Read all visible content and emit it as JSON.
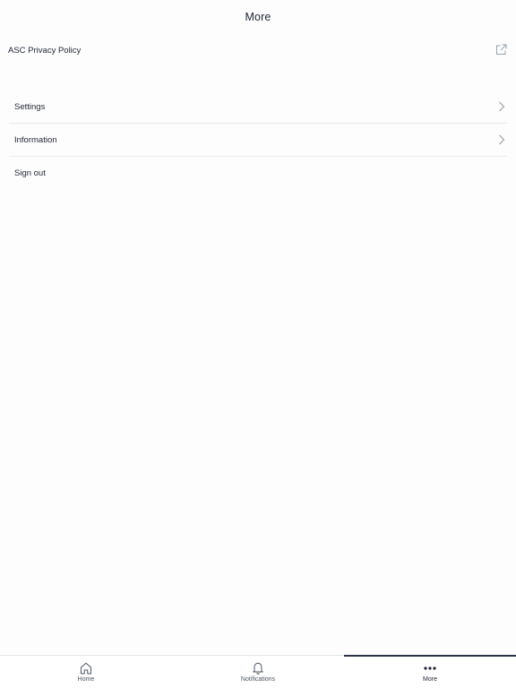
{
  "header": {
    "title": "More"
  },
  "privacy": {
    "label": "ASC Privacy Policy",
    "icon": "external-link-icon"
  },
  "menu": {
    "items": [
      {
        "label": "Settings",
        "icon": "chevron-right-icon"
      },
      {
        "label": "Information",
        "icon": "chevron-right-icon"
      },
      {
        "label": "Sign out"
      }
    ]
  },
  "tabbar": {
    "active": "More",
    "tabs": [
      {
        "label": "Home",
        "icon": "home-icon"
      },
      {
        "label": "Notifications",
        "icon": "bell-icon"
      },
      {
        "label": "More",
        "icon": "more-dots-icon"
      }
    ]
  },
  "colors": {
    "text": "#1f2533",
    "divider": "#e9eaec",
    "active_indicator": "#2b3446",
    "icon": "#9aa1ab"
  }
}
